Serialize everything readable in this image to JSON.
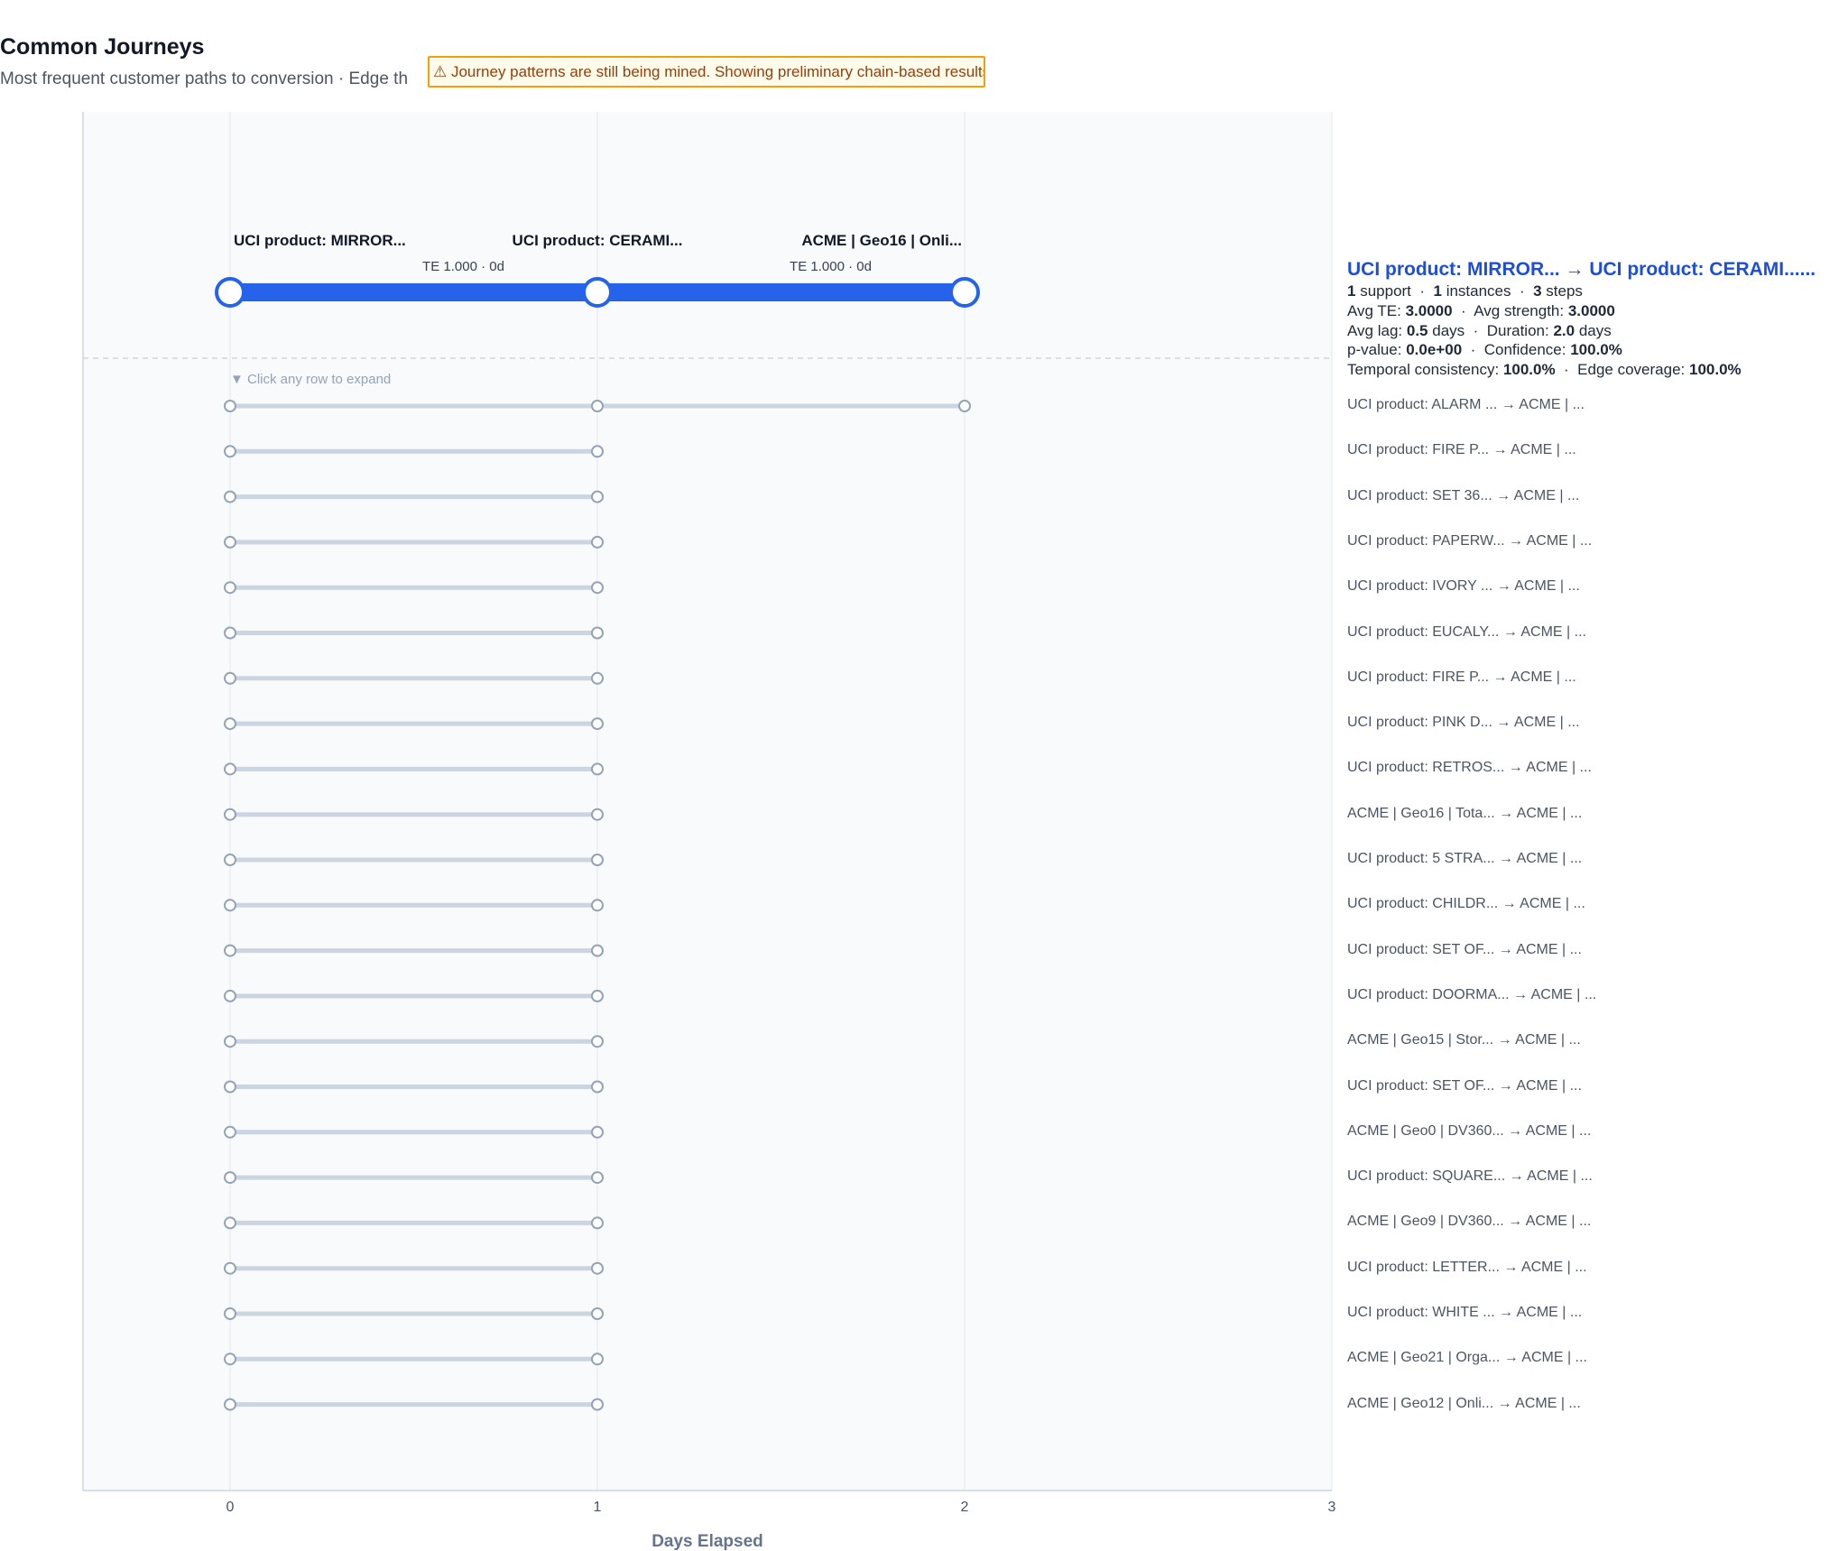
{
  "header": {
    "title": "Common Journeys",
    "subtitle": "Most frequent customer paths to conversion  ·  Edge th",
    "warning_icon": "warning-triangle-icon",
    "warning_text": "⚠ Journey patterns are still being mined. Showing preliminary chain-based results."
  },
  "chart_data": {
    "type": "scatter",
    "xlabel": "Days Elapsed",
    "xlim": [
      0,
      3
    ],
    "xticks": [
      "0",
      "1",
      "2",
      "3"
    ],
    "expand_hint": "▼ Click any row to expand",
    "colors": {
      "highlight": "#2563eb",
      "inactive_line": "#cbd5e1",
      "inactive_marker": "#94a3b8",
      "plot_bg": "#f8fafc"
    },
    "highlighted": {
      "steps": [
        {
          "x": 0,
          "label": "UCI product: MIRROR..."
        },
        {
          "x": 1,
          "label": "UCI product: CERAMI..."
        },
        {
          "x": 2,
          "label": "ACME | Geo16 | Onli..."
        }
      ],
      "edges": [
        {
          "label": "TE 1.000  ·  0d"
        },
        {
          "label": "TE 1.000  ·  0d"
        }
      ]
    },
    "journeys": [
      {
        "x": [
          0,
          1,
          2
        ],
        "label": "UCI product: ALARM ... → ACME | ..."
      },
      {
        "x": [
          0,
          1
        ],
        "label": "UCI product: FIRE P... → ACME | ..."
      },
      {
        "x": [
          0,
          1
        ],
        "label": "UCI product: SET 36... → ACME | ..."
      },
      {
        "x": [
          0,
          1
        ],
        "label": "UCI product: PAPERW... → ACME | ..."
      },
      {
        "x": [
          0,
          1
        ],
        "label": "UCI product: IVORY ... → ACME | ..."
      },
      {
        "x": [
          0,
          1
        ],
        "label": "UCI product: EUCALY... → ACME | ..."
      },
      {
        "x": [
          0,
          1
        ],
        "label": "UCI product: FIRE P... → ACME | ..."
      },
      {
        "x": [
          0,
          1
        ],
        "label": "UCI product: PINK D... → ACME | ..."
      },
      {
        "x": [
          0,
          1
        ],
        "label": "UCI product: RETROS... → ACME | ..."
      },
      {
        "x": [
          0,
          1
        ],
        "label": "ACME | Geo16 | Tota... → ACME | ..."
      },
      {
        "x": [
          0,
          1
        ],
        "label": "UCI product: 5 STRA... → ACME | ..."
      },
      {
        "x": [
          0,
          1
        ],
        "label": "UCI product: CHILDR... → ACME | ..."
      },
      {
        "x": [
          0,
          1
        ],
        "label": "UCI product: SET OF... → ACME | ..."
      },
      {
        "x": [
          0,
          1
        ],
        "label": "UCI product: DOORMA... → ACME | ..."
      },
      {
        "x": [
          0,
          1
        ],
        "label": "ACME | Geo15 | Stor... → ACME | ..."
      },
      {
        "x": [
          0,
          1
        ],
        "label": "UCI product: SET OF... → ACME | ..."
      },
      {
        "x": [
          0,
          1
        ],
        "label": "ACME | Geo0 | DV360... → ACME | ..."
      },
      {
        "x": [
          0,
          1
        ],
        "label": "UCI product: SQUARE... → ACME | ..."
      },
      {
        "x": [
          0,
          1
        ],
        "label": "ACME | Geo9 | DV360... → ACME | ..."
      },
      {
        "x": [
          0,
          1
        ],
        "label": "UCI product: LETTER... → ACME | ..."
      },
      {
        "x": [
          0,
          1
        ],
        "label": "UCI product: WHITE ... → ACME | ..."
      },
      {
        "x": [
          0,
          1
        ],
        "label": "ACME | Geo21 | Orga... → ACME | ..."
      },
      {
        "x": [
          0,
          1
        ],
        "label": "ACME | Geo12 | Onli... → ACME | ..."
      }
    ]
  },
  "detail": {
    "title": "UCI product: MIRROR... → UCI product: CERAMI......",
    "support_value": "1",
    "support_label": "support",
    "instances_value": "1",
    "instances_label": "instances",
    "steps_value": "3",
    "steps_label": "steps",
    "avg_te_label": "Avg TE:",
    "avg_te_value": "3.0000",
    "avg_strength_label": "Avg strength:",
    "avg_strength_value": "3.0000",
    "avg_lag_label": "Avg lag:",
    "avg_lag_value": "0.5",
    "avg_lag_unit": "days",
    "duration_label": "Duration:",
    "duration_value": "2.0",
    "duration_unit": "days",
    "pvalue_label": "p-value:",
    "pvalue_value": "0.0e+00",
    "confidence_label": "Confidence:",
    "confidence_value": "100.0%",
    "temporal_label": "Temporal consistency:",
    "temporal_value": "100.0%",
    "edge_coverage_label": "Edge coverage:",
    "edge_coverage_value": "100.0%",
    "separator": "·"
  }
}
